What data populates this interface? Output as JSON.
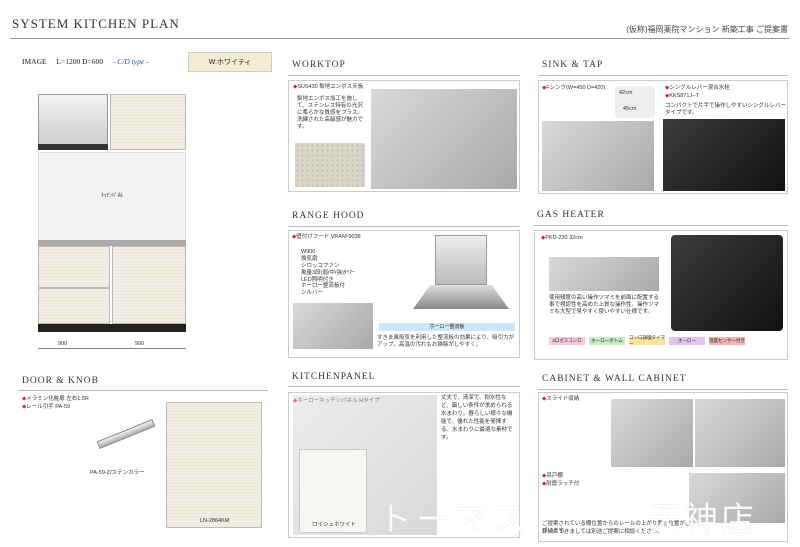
{
  "header": {
    "title": "SYSTEM KITCHEN PLAN",
    "subtitle": "(仮称)福岡薬院マンション 新築工事 ご提案書"
  },
  "kitchen": {
    "image_label": "IMAGE",
    "size_label": "L=1200 D=600",
    "type_label": "- C/D type -",
    "color_label": "W:ホワイティ",
    "panel_note": "ｷｯﾁﾝﾊﾟﾈﾙ",
    "dim_left": "900",
    "dim_right": "900"
  },
  "worktop": {
    "heading": "WORKTOP",
    "spec": "SUS430 梨地エンボス天板",
    "desc": "梨地エンボス加工を施して、ステンレス特有の光沢に柔らかな質感をプラス。洗練された高級感が魅力です。"
  },
  "sink": {
    "heading": "SINK & TAP",
    "spec": "Fシンク(W=450 D=420)",
    "dim1": "42cm",
    "dim2": "45cm",
    "tap_spec": "シングルレバー混合水栓",
    "tap_model": "KKS871J--T",
    "tap_desc": "コンパクトで片手で操作しやすいシングルレバータイプです。"
  },
  "hood": {
    "heading": "RANGE HOOD",
    "spec": "壁付けフード VRAM-9038",
    "features": [
      "W900",
      "換気扇",
      "シロッコファン",
      "風量3段(弱/中/強)ﾀｲﾏｰ",
      "LED照明付き",
      "ホーロー整流板付",
      "シルバー"
    ],
    "badge": "ホーロー整流板",
    "desc": "すきま風吸気を利用した整流板の効果により、吸引力がアップ。高温の汚れもお掃除がしやすく。"
  },
  "gas": {
    "heading": "GAS HEATER",
    "spec": "PKD-230 32cm",
    "desc": "使用頻度の高い操作ツマミを前面に配置する事で視認性を高めた上質な操作性。操作ツマミも大型で見やすく使いやすい仕様です。",
    "tags": [
      "3口ガスコンロ",
      "ホーローボトム",
      "コンロ調理タイマー",
      "ホーロー",
      "温度センサー付き"
    ]
  },
  "door": {
    "heading": "DOOR & KNOB",
    "spec1": "メラミン化粧扉 左右1.5R",
    "spec2": "レール引手 PA-59",
    "knob_label": "PA-59-Z/ステンカラー",
    "panel_label": "LN-2864KM"
  },
  "kpanel": {
    "heading": "KITCHENPANEL",
    "spec": "ホーローキッチンパネル Hタイプ",
    "poem": "丈夫で、清潔で、耐水性など、厳しい条件が求められる水まわり。器らしい様々な機能で、優れた性能を発揮する、水まわりに最適な素材です。",
    "swatch_label": "ロイシェホワイト"
  },
  "cabinet": {
    "heading": "CABINET & WALL CABINET",
    "spec1": "スライド収納",
    "spec2": "吊戸棚",
    "spec3": "耐震ラッチ付",
    "note": "ご提案されている棚位置からのレールの上がり置き位置がございます。",
    "note2": "詳細につきましては別途ご提案に相談ください。"
  },
  "watermark": {
    "left": "トーマス",
    "right": "天神店"
  }
}
